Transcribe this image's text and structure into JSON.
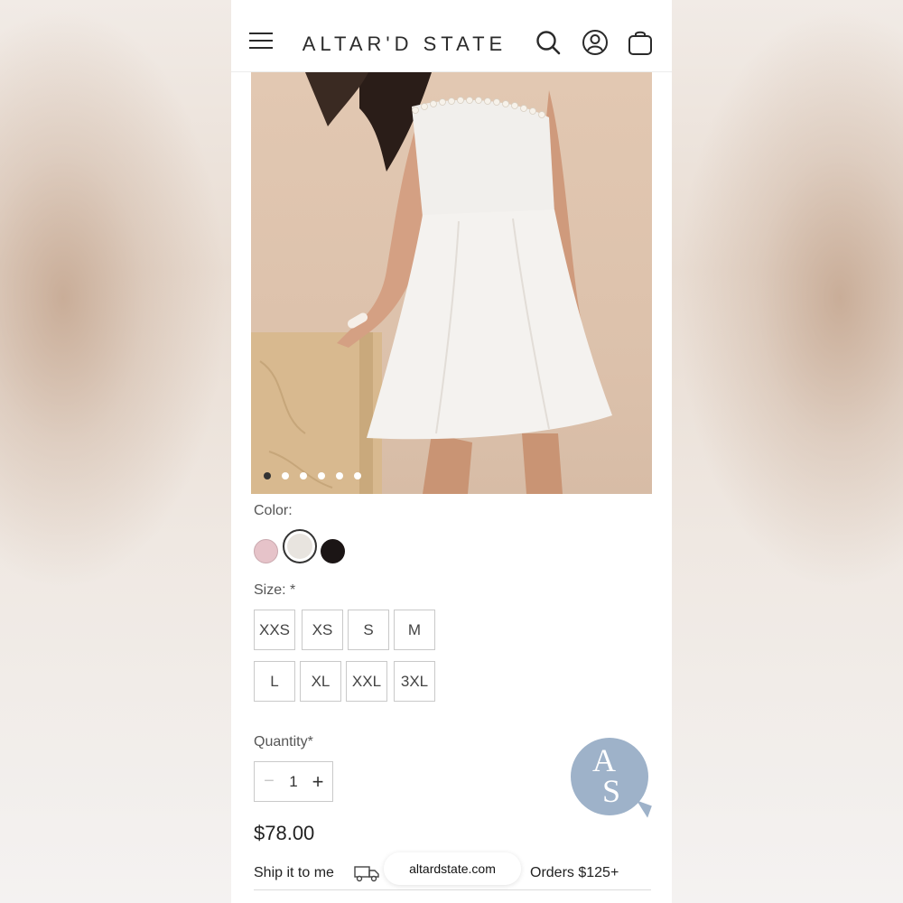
{
  "header": {
    "brand": "ALTAR'D STATE",
    "icons": [
      "menu-icon",
      "search-icon",
      "account-icon",
      "bag-icon"
    ]
  },
  "gallery": {
    "image_alt": "strapless white pearl-trim dress",
    "slide_count": 6,
    "active_slide": 1
  },
  "color": {
    "label": "Color:",
    "options": [
      {
        "name": "blush",
        "hex": "#e6c3c9",
        "selected": false
      },
      {
        "name": "ivory",
        "hex": "#e8e4df",
        "selected": true
      },
      {
        "name": "black",
        "hex": "#1b1515",
        "selected": false
      }
    ]
  },
  "size": {
    "label": "Size: *",
    "options": [
      "XXS",
      "XS",
      "S",
      "M",
      "L",
      "XL",
      "XXL",
      "3XL"
    ]
  },
  "quantity": {
    "label": "Quantity*",
    "value": "1",
    "minus": "−",
    "plus": "+"
  },
  "price": "$78.00",
  "chat": {
    "letters": "AS"
  },
  "shipping": {
    "ship_label": "Ship it to me",
    "free_label": "Orders $125+"
  },
  "browser": {
    "url": "altardstate.com"
  }
}
